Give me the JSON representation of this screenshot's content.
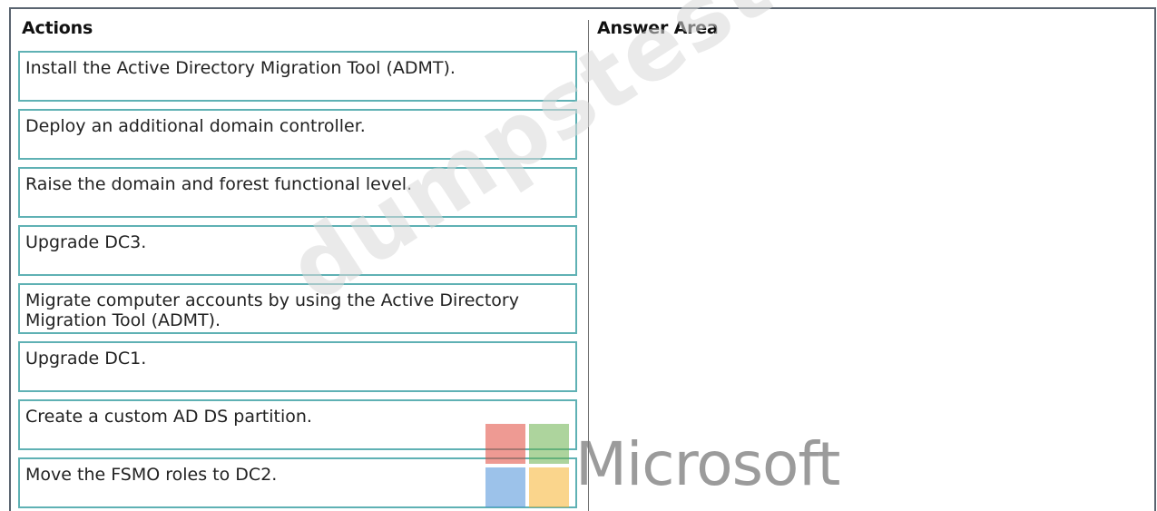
{
  "headings": {
    "actions": "Actions",
    "answer_area": "Answer Area"
  },
  "actions": [
    "Install the Active Directory Migration Tool (ADMT).",
    "Deploy an additional domain controller.",
    "Raise the domain and forest functional level.",
    "Upgrade DC3.",
    "Migrate computer accounts by using the Active Directory Migration Tool (ADMT).",
    "Upgrade DC1.",
    "Create a custom AD DS partition.",
    "Move the FSMO roles to DC2."
  ],
  "branding": {
    "logo_text": "Microsoft",
    "watermark": "dumpstests.com"
  }
}
